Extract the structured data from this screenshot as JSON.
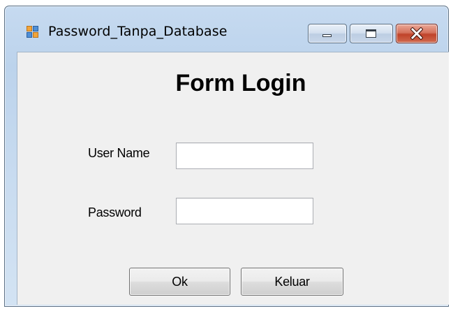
{
  "window": {
    "title": "Password_Tanpa_Database",
    "icon": "winforms-app-icon",
    "controls": {
      "minimize": "minimize-icon",
      "maximize": "maximize-icon",
      "close": "close-icon"
    }
  },
  "form": {
    "heading": "Form Login",
    "username_label": "User Name",
    "username_value": "",
    "password_label": "Password",
    "password_value": "",
    "ok_label": "Ok",
    "keluar_label": "Keluar"
  },
  "colors": {
    "window_frame": "#c6daf0",
    "client_background": "#f0f0f0",
    "close_button": "#c0432a"
  }
}
